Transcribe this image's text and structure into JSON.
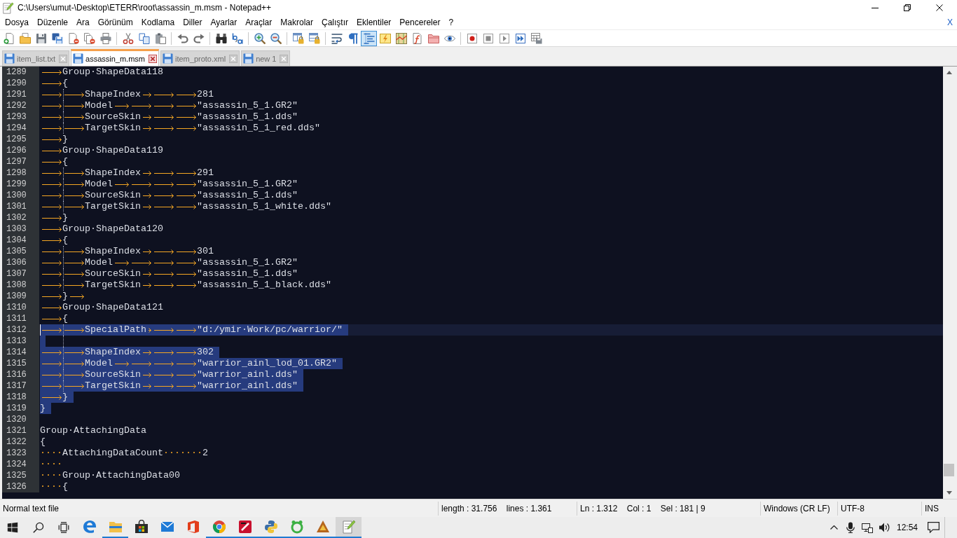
{
  "window": {
    "title": "C:\\Users\\umut-\\Desktop\\ETERR\\root\\assassin_m.msm - Notepad++"
  },
  "menu": {
    "items": [
      "Dosya",
      "Düzenle",
      "Ara",
      "Görünüm",
      "Kodlama",
      "Diller",
      "Ayarlar",
      "Araçlar",
      "Makrolar",
      "Çalıştır",
      "Eklentiler",
      "Pencereler",
      "?"
    ],
    "close_document": "X"
  },
  "toolbar": {
    "groups": [
      [
        {
          "kind": "new",
          "on": false
        },
        {
          "kind": "open",
          "on": false
        },
        {
          "kind": "save",
          "on": false
        },
        {
          "kind": "saveall",
          "on": false
        },
        {
          "kind": "close",
          "on": false
        },
        {
          "kind": "closeall",
          "on": false
        },
        {
          "kind": "print",
          "on": false
        }
      ],
      [
        {
          "kind": "cut",
          "on": false
        },
        {
          "kind": "copy",
          "on": false
        },
        {
          "kind": "paste",
          "on": false
        }
      ],
      [
        {
          "kind": "undo",
          "on": false
        },
        {
          "kind": "redo",
          "on": false
        }
      ],
      [
        {
          "kind": "find",
          "on": false
        },
        {
          "kind": "replace",
          "on": false
        }
      ],
      [
        {
          "kind": "zoomin",
          "on": false
        },
        {
          "kind": "zoomout",
          "on": false
        }
      ],
      [
        {
          "kind": "syncv",
          "on": false
        },
        {
          "kind": "synch",
          "on": false
        }
      ],
      [
        {
          "kind": "wrap",
          "on": false
        },
        {
          "kind": "pilcrow",
          "on": false
        },
        {
          "kind": "guides",
          "on": true
        },
        {
          "kind": "udl",
          "on": false
        },
        {
          "kind": "docmap",
          "on": false
        },
        {
          "kind": "funclist",
          "on": false
        },
        {
          "kind": "folder",
          "on": false
        },
        {
          "kind": "monitor",
          "on": false
        }
      ],
      [
        {
          "kind": "record",
          "on": false
        },
        {
          "kind": "stop",
          "on": false
        },
        {
          "kind": "play",
          "on": false
        },
        {
          "kind": "playmulti",
          "on": false
        },
        {
          "kind": "savemacro",
          "on": false
        }
      ]
    ]
  },
  "tabs": [
    {
      "label": "item_list.txt",
      "selected": false
    },
    {
      "label": "assassin_m.msm",
      "selected": true
    },
    {
      "label": "item_proto.xml",
      "selected": false
    },
    {
      "label": "new 1",
      "selected": false
    }
  ],
  "editor": {
    "lines": [
      {
        "number": "1289",
        "selected": false,
        "current": false,
        "guide": false,
        "tokens": [
          {
            "kind": "tab"
          },
          {
            "kind": "text",
            "text": "Group·ShapeData118"
          }
        ]
      },
      {
        "number": "1290",
        "selected": false,
        "current": false,
        "guide": false,
        "tokens": [
          {
            "kind": "tab"
          },
          {
            "kind": "text",
            "text": "{"
          }
        ]
      },
      {
        "number": "1291",
        "selected": false,
        "current": false,
        "guide": true,
        "tokens": [
          {
            "kind": "tab"
          },
          {
            "kind": "tab"
          },
          {
            "kind": "text",
            "text": "ShapeIndex"
          },
          {
            "kind": "tab"
          },
          {
            "kind": "tab"
          },
          {
            "kind": "tab"
          },
          {
            "kind": "text",
            "text": "281"
          }
        ]
      },
      {
        "number": "1292",
        "selected": false,
        "current": false,
        "guide": true,
        "tokens": [
          {
            "kind": "tab"
          },
          {
            "kind": "tab"
          },
          {
            "kind": "text",
            "text": "Model"
          },
          {
            "kind": "tab"
          },
          {
            "kind": "tab"
          },
          {
            "kind": "tab"
          },
          {
            "kind": "tab"
          },
          {
            "kind": "text",
            "text": "\"assassin_5_1.GR2\""
          }
        ]
      },
      {
        "number": "1293",
        "selected": false,
        "current": false,
        "guide": true,
        "tokens": [
          {
            "kind": "tab"
          },
          {
            "kind": "tab"
          },
          {
            "kind": "text",
            "text": "SourceSkin"
          },
          {
            "kind": "tab"
          },
          {
            "kind": "tab"
          },
          {
            "kind": "tab"
          },
          {
            "kind": "text",
            "text": "\"assassin_5_1.dds\""
          }
        ]
      },
      {
        "number": "1294",
        "selected": false,
        "current": false,
        "guide": true,
        "tokens": [
          {
            "kind": "tab"
          },
          {
            "kind": "tab"
          },
          {
            "kind": "text",
            "text": "TargetSkin"
          },
          {
            "kind": "tab"
          },
          {
            "kind": "tab"
          },
          {
            "kind": "tab"
          },
          {
            "kind": "text",
            "text": "\"assassin_5_1_red.dds\""
          }
        ]
      },
      {
        "number": "1295",
        "selected": false,
        "current": false,
        "guide": false,
        "tokens": [
          {
            "kind": "tab"
          },
          {
            "kind": "text",
            "text": "}"
          }
        ]
      },
      {
        "number": "1296",
        "selected": false,
        "current": false,
        "guide": false,
        "tokens": [
          {
            "kind": "tab"
          },
          {
            "kind": "text",
            "text": "Group·ShapeData119"
          }
        ]
      },
      {
        "number": "1297",
        "selected": false,
        "current": false,
        "guide": false,
        "tokens": [
          {
            "kind": "tab"
          },
          {
            "kind": "text",
            "text": "{"
          }
        ]
      },
      {
        "number": "1298",
        "selected": false,
        "current": false,
        "guide": true,
        "tokens": [
          {
            "kind": "tab"
          },
          {
            "kind": "tab"
          },
          {
            "kind": "text",
            "text": "ShapeIndex"
          },
          {
            "kind": "tab"
          },
          {
            "kind": "tab"
          },
          {
            "kind": "tab"
          },
          {
            "kind": "text",
            "text": "291"
          }
        ]
      },
      {
        "number": "1299",
        "selected": false,
        "current": false,
        "guide": true,
        "tokens": [
          {
            "kind": "tab"
          },
          {
            "kind": "tab"
          },
          {
            "kind": "text",
            "text": "Model"
          },
          {
            "kind": "tab"
          },
          {
            "kind": "tab"
          },
          {
            "kind": "tab"
          },
          {
            "kind": "tab"
          },
          {
            "kind": "text",
            "text": "\"assassin_5_1.GR2\""
          }
        ]
      },
      {
        "number": "1300",
        "selected": false,
        "current": false,
        "guide": true,
        "tokens": [
          {
            "kind": "tab"
          },
          {
            "kind": "tab"
          },
          {
            "kind": "text",
            "text": "SourceSkin"
          },
          {
            "kind": "tab"
          },
          {
            "kind": "tab"
          },
          {
            "kind": "tab"
          },
          {
            "kind": "text",
            "text": "\"assassin_5_1.dds\""
          }
        ]
      },
      {
        "number": "1301",
        "selected": false,
        "current": false,
        "guide": true,
        "tokens": [
          {
            "kind": "tab"
          },
          {
            "kind": "tab"
          },
          {
            "kind": "text",
            "text": "TargetSkin"
          },
          {
            "kind": "tab"
          },
          {
            "kind": "tab"
          },
          {
            "kind": "tab"
          },
          {
            "kind": "text",
            "text": "\"assassin_5_1_white.dds\""
          }
        ]
      },
      {
        "number": "1302",
        "selected": false,
        "current": false,
        "guide": false,
        "tokens": [
          {
            "kind": "tab"
          },
          {
            "kind": "text",
            "text": "}"
          }
        ]
      },
      {
        "number": "1303",
        "selected": false,
        "current": false,
        "guide": false,
        "tokens": [
          {
            "kind": "tab"
          },
          {
            "kind": "text",
            "text": "Group·ShapeData120"
          }
        ]
      },
      {
        "number": "1304",
        "selected": false,
        "current": false,
        "guide": false,
        "tokens": [
          {
            "kind": "tab"
          },
          {
            "kind": "text",
            "text": "{"
          }
        ]
      },
      {
        "number": "1305",
        "selected": false,
        "current": false,
        "guide": true,
        "tokens": [
          {
            "kind": "tab"
          },
          {
            "kind": "tab"
          },
          {
            "kind": "text",
            "text": "ShapeIndex"
          },
          {
            "kind": "tab"
          },
          {
            "kind": "tab"
          },
          {
            "kind": "tab"
          },
          {
            "kind": "text",
            "text": "301"
          }
        ]
      },
      {
        "number": "1306",
        "selected": false,
        "current": false,
        "guide": true,
        "tokens": [
          {
            "kind": "tab"
          },
          {
            "kind": "tab"
          },
          {
            "kind": "text",
            "text": "Model"
          },
          {
            "kind": "tab"
          },
          {
            "kind": "tab"
          },
          {
            "kind": "tab"
          },
          {
            "kind": "tab"
          },
          {
            "kind": "text",
            "text": "\"assassin_5_1.GR2\""
          }
        ]
      },
      {
        "number": "1307",
        "selected": false,
        "current": false,
        "guide": true,
        "tokens": [
          {
            "kind": "tab"
          },
          {
            "kind": "tab"
          },
          {
            "kind": "text",
            "text": "SourceSkin"
          },
          {
            "kind": "tab"
          },
          {
            "kind": "tab"
          },
          {
            "kind": "tab"
          },
          {
            "kind": "text",
            "text": "\"assassin_5_1.dds\""
          }
        ]
      },
      {
        "number": "1308",
        "selected": false,
        "current": false,
        "guide": true,
        "tokens": [
          {
            "kind": "tab"
          },
          {
            "kind": "tab"
          },
          {
            "kind": "text",
            "text": "TargetSkin"
          },
          {
            "kind": "tab"
          },
          {
            "kind": "tab"
          },
          {
            "kind": "tab"
          },
          {
            "kind": "text",
            "text": "\"assassin_5_1_black.dds\""
          }
        ]
      },
      {
        "number": "1309",
        "selected": false,
        "current": false,
        "guide": false,
        "tokens": [
          {
            "kind": "tab"
          },
          {
            "kind": "text",
            "text": "}"
          },
          {
            "kind": "tab"
          }
        ]
      },
      {
        "number": "1310",
        "selected": false,
        "current": false,
        "guide": false,
        "tokens": [
          {
            "kind": "tab"
          },
          {
            "kind": "text",
            "text": "Group·ShapeData121"
          }
        ]
      },
      {
        "number": "1311",
        "selected": false,
        "current": false,
        "guide": false,
        "tokens": [
          {
            "kind": "tab"
          },
          {
            "kind": "text",
            "text": "{"
          }
        ]
      },
      {
        "number": "1312",
        "selected": true,
        "current": true,
        "guide": true,
        "tokens": [
          {
            "kind": "tab"
          },
          {
            "kind": "tab"
          },
          {
            "kind": "text",
            "text": "SpecialPath"
          },
          {
            "kind": "tab"
          },
          {
            "kind": "tab"
          },
          {
            "kind": "tab"
          },
          {
            "kind": "text",
            "text": "\"d:/ymir·Work/pc/warrior/\""
          }
        ]
      },
      {
        "number": "1313",
        "selected": true,
        "current": false,
        "guide": true
      },
      {
        "number": "1314",
        "selected": true,
        "current": false,
        "guide": true,
        "tokens": [
          {
            "kind": "tab"
          },
          {
            "kind": "tab"
          },
          {
            "kind": "text",
            "text": "ShapeIndex"
          },
          {
            "kind": "tab"
          },
          {
            "kind": "tab"
          },
          {
            "kind": "tab"
          },
          {
            "kind": "text",
            "text": "302"
          }
        ]
      },
      {
        "number": "1315",
        "selected": true,
        "current": false,
        "guide": true,
        "tokens": [
          {
            "kind": "tab"
          },
          {
            "kind": "tab"
          },
          {
            "kind": "text",
            "text": "Model"
          },
          {
            "kind": "tab"
          },
          {
            "kind": "tab"
          },
          {
            "kind": "tab"
          },
          {
            "kind": "tab"
          },
          {
            "kind": "text",
            "text": "\"warrior_ainl_lod_01.GR2\""
          }
        ]
      },
      {
        "number": "1316",
        "selected": true,
        "current": false,
        "guide": true,
        "tokens": [
          {
            "kind": "tab"
          },
          {
            "kind": "tab"
          },
          {
            "kind": "text",
            "text": "SourceSkin"
          },
          {
            "kind": "tab"
          },
          {
            "kind": "tab"
          },
          {
            "kind": "tab"
          },
          {
            "kind": "text",
            "text": "\"warrior_ainl.dds\""
          }
        ]
      },
      {
        "number": "1317",
        "selected": true,
        "current": false,
        "guide": true,
        "tokens": [
          {
            "kind": "tab"
          },
          {
            "kind": "tab"
          },
          {
            "kind": "text",
            "text": "TargetSkin"
          },
          {
            "kind": "tab"
          },
          {
            "kind": "tab"
          },
          {
            "kind": "tab"
          },
          {
            "kind": "text",
            "text": "\"warrior_ainl.dds\""
          }
        ]
      },
      {
        "number": "1318",
        "selected": true,
        "current": false,
        "guide": false,
        "tokens": [
          {
            "kind": "tab"
          },
          {
            "kind": "text",
            "text": "}"
          }
        ]
      },
      {
        "number": "1319",
        "selected": true,
        "current": false,
        "guide": false,
        "tokens": [
          {
            "kind": "text",
            "text": "}"
          }
        ]
      },
      {
        "number": "1320",
        "selected": false,
        "current": false,
        "guide": false
      },
      {
        "number": "1321",
        "selected": false,
        "current": false,
        "guide": false,
        "tokens": [
          {
            "kind": "text",
            "text": "Group·AttachingData"
          }
        ]
      },
      {
        "number": "1322",
        "selected": false,
        "current": false,
        "guide": false,
        "tokens": [
          {
            "kind": "text",
            "text": "{"
          }
        ]
      },
      {
        "number": "1323",
        "selected": false,
        "current": false,
        "guide": false,
        "tokens": [
          {
            "kind": "space",
            "text": "····"
          },
          {
            "kind": "text",
            "text": "AttachingDataCount"
          },
          {
            "kind": "space",
            "text": "·······"
          },
          {
            "kind": "text",
            "text": "2"
          }
        ]
      },
      {
        "number": "1324",
        "selected": false,
        "current": false,
        "guide": false,
        "tokens": [
          {
            "kind": "space",
            "text": "····"
          }
        ]
      },
      {
        "number": "1325",
        "selected": false,
        "current": false,
        "guide": false,
        "tokens": [
          {
            "kind": "space",
            "text": "····"
          },
          {
            "kind": "text",
            "text": "Group·AttachingData00"
          }
        ]
      },
      {
        "number": "1326",
        "selected": false,
        "current": false,
        "guide": false,
        "tokens": [
          {
            "kind": "space",
            "text": "····"
          },
          {
            "kind": "text",
            "text": "{"
          }
        ]
      }
    ]
  },
  "status_bar": {
    "fields": [
      "Normal text file",
      "length : 31.756    lines : 1.361",
      "Ln : 1.312    Col : 1    Sel : 181 | 9",
      "Windows (CR LF)",
      "UTF-8",
      "INS"
    ]
  },
  "taskbar": {
    "apps": [
      {
        "kind": "edge",
        "running": false,
        "selected": false
      },
      {
        "kind": "explorer",
        "running": true,
        "selected": false
      },
      {
        "kind": "store",
        "running": false,
        "selected": false
      },
      {
        "kind": "mail",
        "running": false,
        "selected": false
      },
      {
        "kind": "office",
        "running": false,
        "selected": false
      },
      {
        "kind": "chrome",
        "running": true,
        "selected": false
      },
      {
        "kind": "redtile",
        "running": true,
        "selected": false
      },
      {
        "kind": "python",
        "running": true,
        "selected": false
      },
      {
        "kind": "greenring",
        "running": true,
        "selected": false
      },
      {
        "kind": "triangle",
        "running": true,
        "selected": false
      },
      {
        "kind": "notepad",
        "running": true,
        "selected": true
      }
    ],
    "clock": "12:54"
  }
}
